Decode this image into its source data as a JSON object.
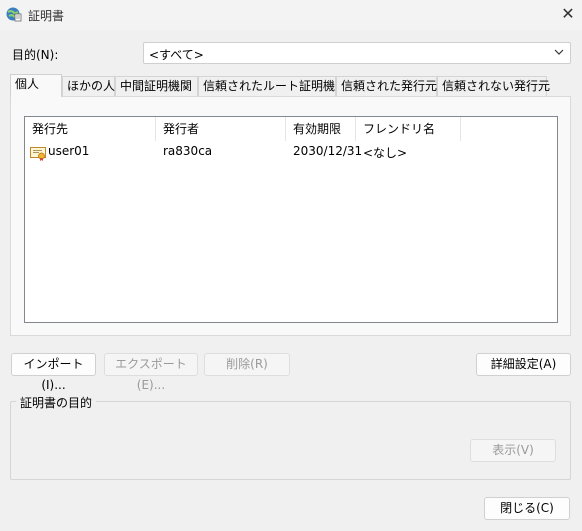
{
  "window": {
    "title": "証明書",
    "close_icon": "close-icon"
  },
  "purpose": {
    "label": "目的(N):",
    "value": "<すべて>"
  },
  "tabs": [
    {
      "label": "個人",
      "active": true
    },
    {
      "label": "ほかの人",
      "active": false
    },
    {
      "label": "中間証明機関",
      "active": false
    },
    {
      "label": "信頼されたルート証明機関",
      "active": false
    },
    {
      "label": "信頼された発行元",
      "active": false
    },
    {
      "label": "信頼されない発行元",
      "active": false
    }
  ],
  "list": {
    "columns": [
      "発行先",
      "発行者",
      "有効期限",
      "フレンドリ名"
    ],
    "rows": [
      {
        "issued_to": "user01",
        "issued_by": "ra830ca",
        "expiration": "2030/12/31",
        "friendly_name": "<なし>",
        "icon": "certificate-icon"
      }
    ]
  },
  "buttons": {
    "import": "インポート(I)...",
    "export": "エクスポート(E)...",
    "remove": "削除(R)",
    "advanced": "詳細設定(A)",
    "view": "表示(V)",
    "close": "閉じる(C)"
  },
  "purposes_group": {
    "title": "証明書の目的"
  }
}
